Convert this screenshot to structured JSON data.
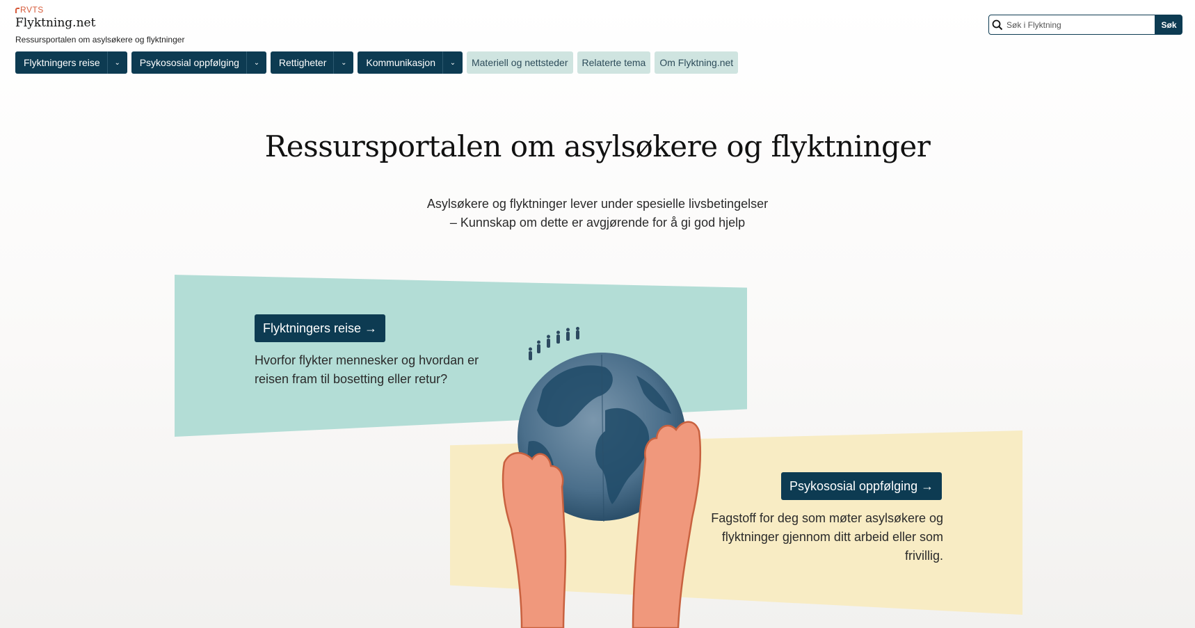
{
  "header": {
    "org_logo": "RVTS",
    "site_name": "Flyktning.net",
    "tagline": "Ressursportalen om asylsøkere og flyktninger"
  },
  "search": {
    "placeholder": "Søk i Flyktning",
    "button_label": "Søk",
    "icon": "search-icon"
  },
  "nav": {
    "dropdown_items": [
      {
        "label": "Flyktningers reise"
      },
      {
        "label": "Psykososial oppfølging"
      },
      {
        "label": "Rettigheter"
      },
      {
        "label": "Kommunikasjon"
      }
    ],
    "links": [
      {
        "label": "Materiell og nettsteder"
      },
      {
        "label": "Relaterte tema"
      },
      {
        "label": "Om Flyktning.net"
      }
    ]
  },
  "hero": {
    "title": "Ressursportalen om asylsøkere og flyktninger",
    "subtitle_line1": "Asylsøkere og flyktninger lever under spesielle livsbetingelser",
    "subtitle_line2": "– Kunnskap om dette er avgjørende for å gi god hjelp"
  },
  "cards": [
    {
      "button_label": "Flyktningers reise →",
      "text": "Hvorfor flykter mennesker og hvordan er reisen fram til bosetting eller retur?"
    },
    {
      "button_label": "Psykososial oppfølging →",
      "text": "Fagstoff for deg som møter asylsøkere og flyktninger gjennom ditt arbeid eller som frivillig."
    }
  ],
  "colors": {
    "primary": "#0d3b52",
    "nav_light": "#cfe4e0",
    "teal_card": "#b3ddd6",
    "yellow_card": "#f8ecc4",
    "rvts_accent": "#d65a3a"
  }
}
